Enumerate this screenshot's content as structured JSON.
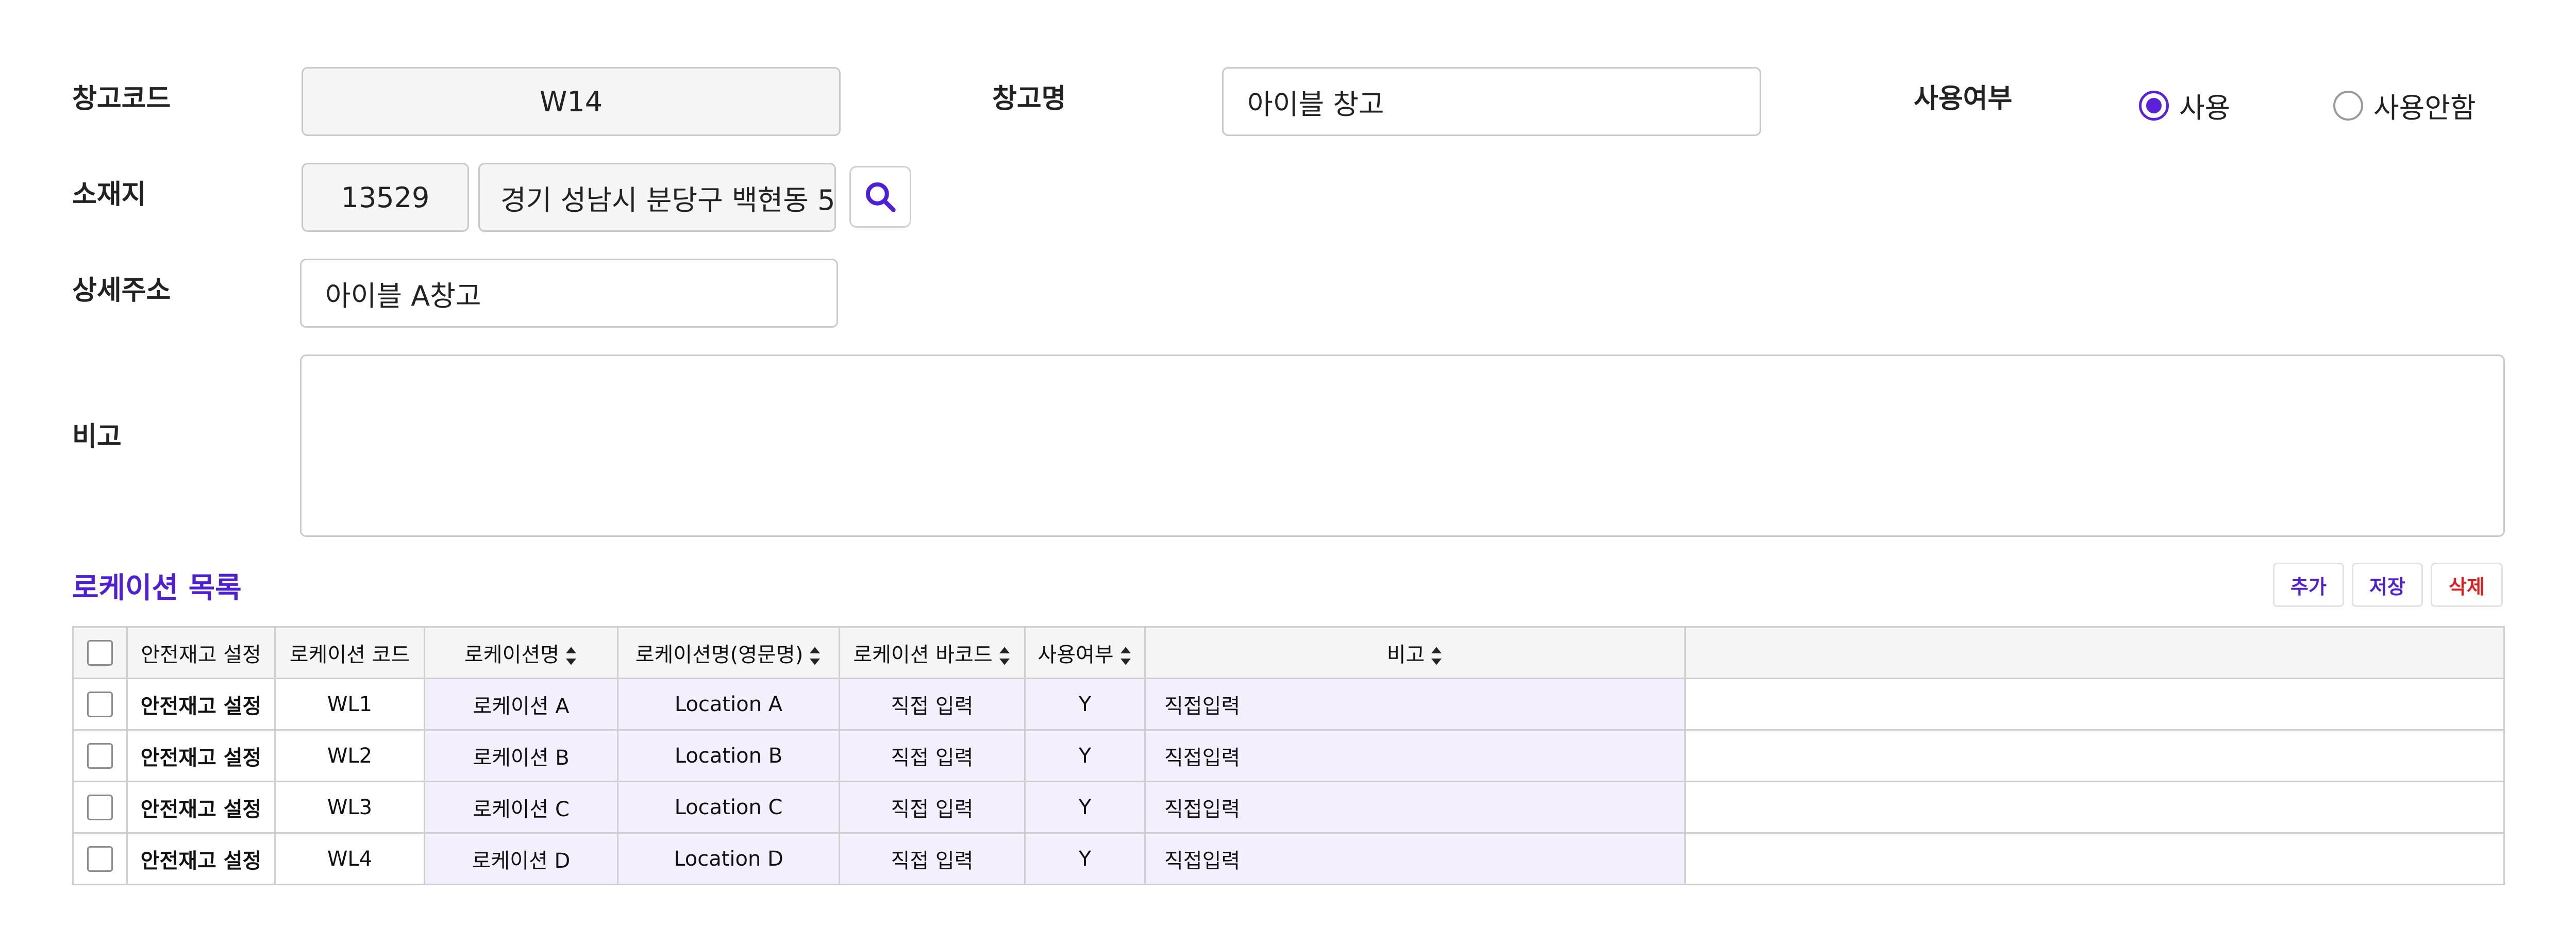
{
  "form": {
    "warehouse_code_label": "창고코드",
    "warehouse_code_value": "W14",
    "warehouse_name_label": "창고명",
    "warehouse_name_value": "아이블 창고",
    "use_label": "사용여부",
    "use_options": [
      "사용",
      "사용안함"
    ],
    "use_selected": "사용",
    "location_label": "소재지",
    "zipcode": "13529",
    "address": "경기 성남시 분당구 백현동 5",
    "detail_label": "상세주소",
    "detail_value": "아이블 A창고",
    "memo_label": "비고",
    "memo_value": ""
  },
  "location_list": {
    "title": "로케이션 목록",
    "buttons": {
      "add": "추가",
      "save": "저장",
      "delete": "삭제"
    },
    "button_colors": {
      "add": "#4f1fd6",
      "save": "#4f1fd6",
      "delete": "#e01b1b"
    },
    "columns": [
      "안전재고 설정",
      "로케이션 코드",
      "로케이션명",
      "로케이션명(영문명)",
      "로케이션 바코드",
      "사용여부",
      "비고"
    ],
    "rows": [
      {
        "safety": "안전재고 설정",
        "code": "WL1",
        "name": "로케이션 A",
        "name_en": "Location A",
        "barcode_ph": "직접 입력",
        "use": "Y",
        "memo_ph": "직접입력"
      },
      {
        "safety": "안전재고 설정",
        "code": "WL2",
        "name": "로케이션 B",
        "name_en": "Location B",
        "barcode_ph": "직접 입력",
        "use": "Y",
        "memo_ph": "직접입력"
      },
      {
        "safety": "안전재고 설정",
        "code": "WL3",
        "name": "로케이션 C",
        "name_en": "Location C",
        "barcode_ph": "직접 입력",
        "use": "Y",
        "memo_ph": "직접입력"
      },
      {
        "safety": "안전재고 설정",
        "code": "WL4",
        "name": "로케이션 D",
        "name_en": "Location D",
        "barcode_ph": "직접 입력",
        "use": "Y",
        "memo_ph": "직접입력"
      }
    ]
  },
  "icons": {
    "search": "search-icon",
    "sort": "sort-icon"
  },
  "colors": {
    "accent": "#5b21d9",
    "link": "#1a35d6",
    "row_tint": "#f4effd"
  }
}
